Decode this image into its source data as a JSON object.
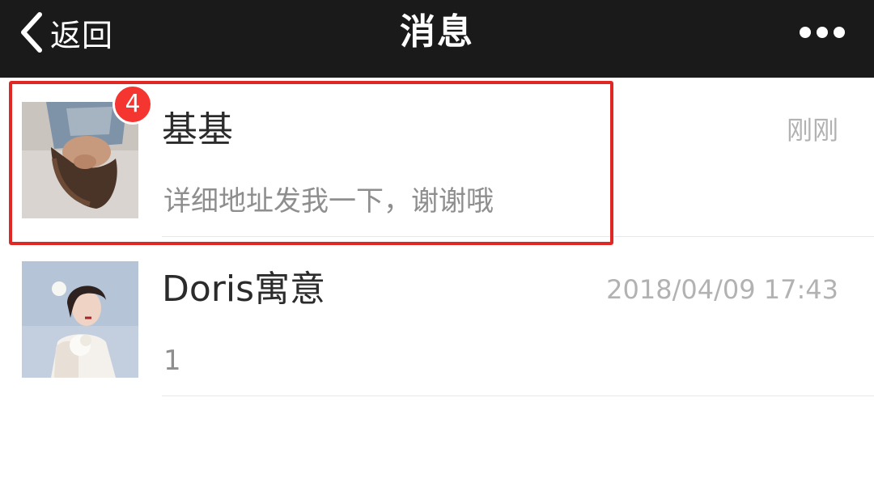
{
  "nav": {
    "back_label": "返回",
    "title": "消息",
    "more_icon": "ellipsis-icon",
    "back_icon": "chevron-left-icon",
    "background": "#1a1a1a"
  },
  "conversations": [
    {
      "name": "基基",
      "time": "刚刚",
      "preview": "详细地址发我一下，谢谢哦",
      "unread": "4",
      "highlighted": true
    },
    {
      "name": "Doris寓意",
      "time": "2018/04/09 17:43",
      "preview": "1"
    }
  ],
  "colors": {
    "badge": "#f43530",
    "highlight": "#e02724",
    "time": "#b2b2b2",
    "preview": "#8e8e8e"
  }
}
